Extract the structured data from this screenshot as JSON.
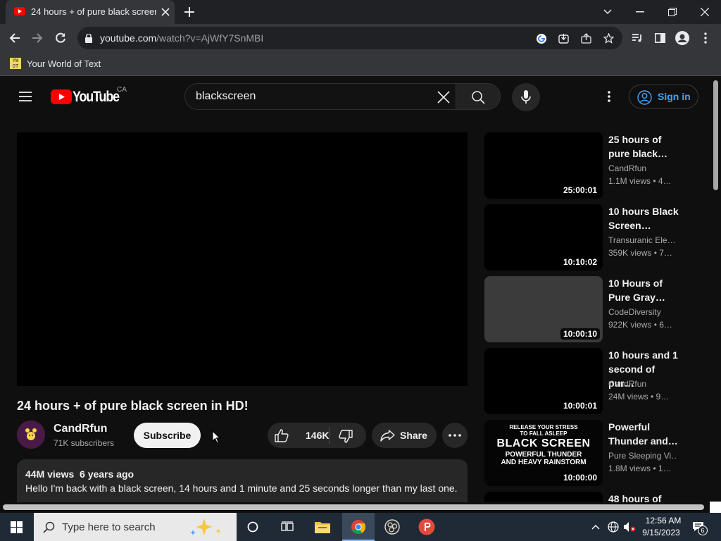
{
  "browser": {
    "tab_title": "24 hours + of pure black screen in",
    "url_host": "youtube.com",
    "url_path": "/watch?v=AjWfY7SnMBI",
    "bookmark_label": "Your World of Text",
    "bookmark_icon_text": "YW OT"
  },
  "header": {
    "logo_text": "YouTube",
    "region": "CA",
    "search_value": "blackscreen",
    "signin_label": "Sign in"
  },
  "video": {
    "title": "24 hours + of pure black screen in HD!",
    "channel": "CandRfun",
    "subscribers": "71K subscribers",
    "subscribe_label": "Subscribe",
    "likes": "146K",
    "share_label": "Share",
    "desc_meta": "44M views  6 years ago",
    "desc_text": "Hello I'm back with a black screen, 14 hours and 1 minute and 25 seconds longer than my last one."
  },
  "related": [
    {
      "title_1": "25 hours of",
      "title_2": "pure black…",
      "channel": "CandRfun",
      "views": "1.1M views  • 4…",
      "duration": "25:00:01",
      "thumb_color": "#000000"
    },
    {
      "title_1": "10 hours Black",
      "title_2": "Screen…",
      "channel": "Transuranic Ele…",
      "views": "359K views  • 7…",
      "duration": "10:10:02",
      "thumb_color": "#000000"
    },
    {
      "title_1": "10 Hours of",
      "title_2": "Pure Gray…",
      "channel": "CodeDiversity",
      "views": "922K views  • 6…",
      "duration": "10:00:10",
      "thumb_color": "#3b3b3b"
    },
    {
      "title_1": "10 hours and 1",
      "title_2": "second of pur…",
      "channel": "CandRfun",
      "views": "24M views  • 9…",
      "duration": "10:00:01",
      "thumb_color": "#000000"
    },
    {
      "title_1": "Powerful",
      "title_2": "Thunder and…",
      "channel": "Pure Sleeping Vi…",
      "views": "1.8M views  • 1…",
      "duration": "10:00:00",
      "thumb_color": "#000000",
      "thumb_line_1": "RELEASE YOUR STRESS",
      "thumb_line_2": "TO FALL ASLEEP",
      "thumb_line_3": "BLACK SCREEN",
      "thumb_line_4": "POWERFUL THUNDER",
      "thumb_line_5": "AND HEAVY RAINSTORM"
    },
    {
      "title_1": "48 hours of",
      "title_2": "",
      "channel": "",
      "views": "",
      "duration": "",
      "thumb_color": "#000000"
    }
  ],
  "taskbar": {
    "search_placeholder": "Type here to search",
    "time": "12:56 AM",
    "date": "9/15/2023",
    "notification_count": "6"
  }
}
